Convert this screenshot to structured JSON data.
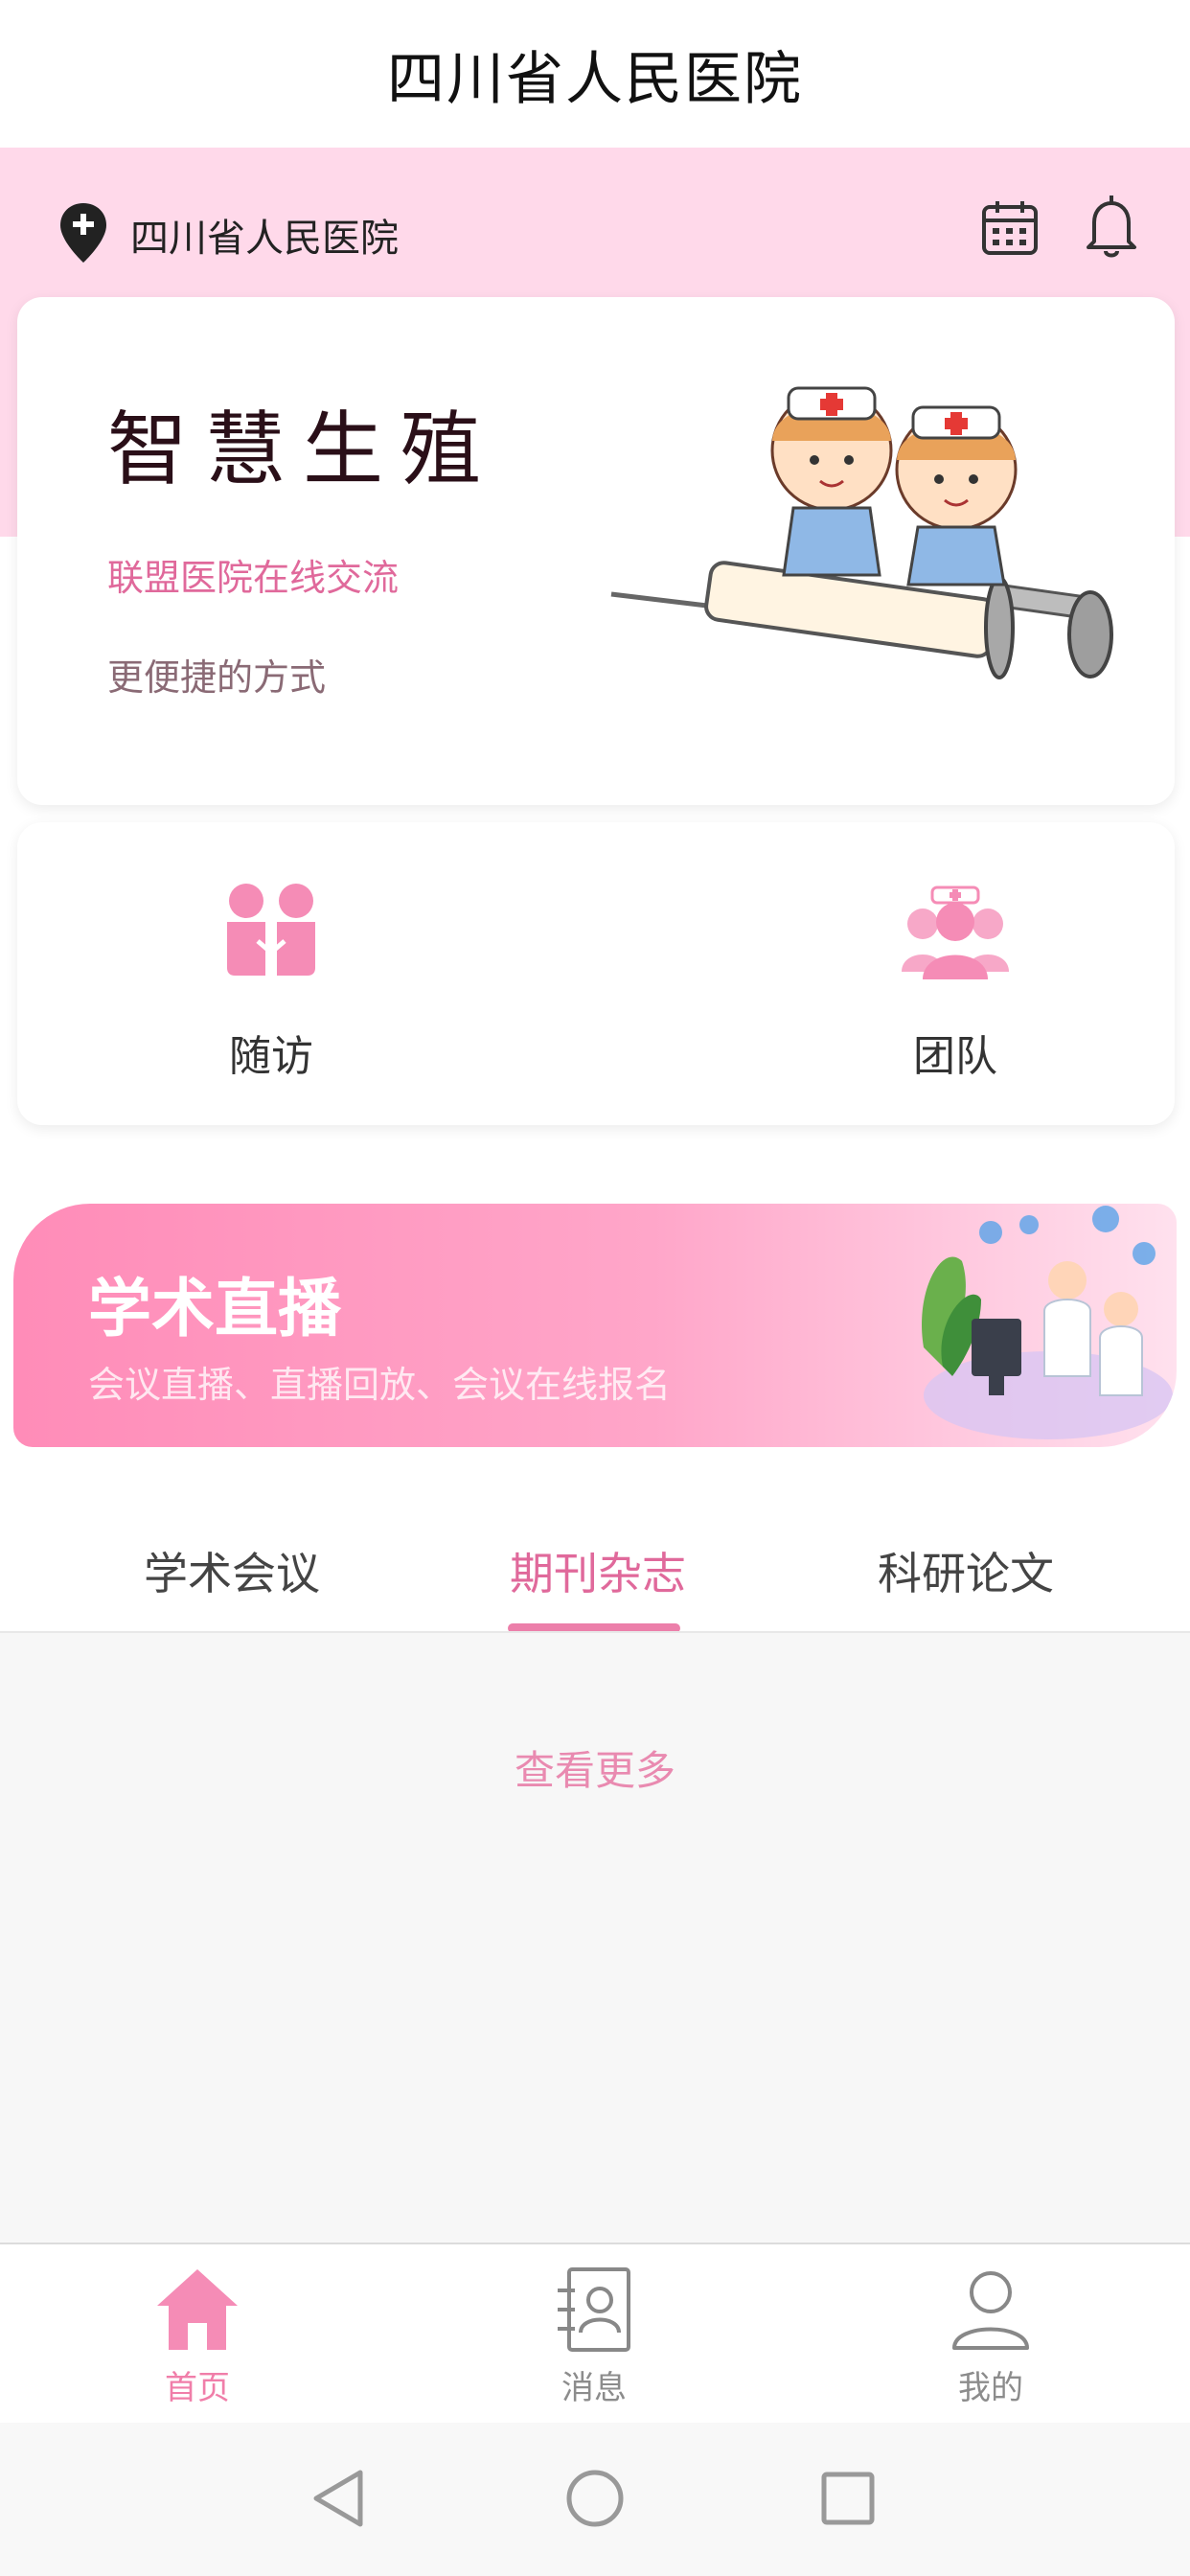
{
  "app": {
    "title": "四川省人民医院"
  },
  "header": {
    "location": "四川省人民医院",
    "location_icon": "location-pin-icon",
    "calendar_icon": "calendar-icon",
    "bell_icon": "bell-icon",
    "band_color": "#ffd9ea"
  },
  "hero": {
    "title": "智慧生殖",
    "subtitle_accent": "联盟医院在线交流",
    "subtitle": "更便捷的方式",
    "illustration": "nurses-on-syringe-illustration"
  },
  "quick_actions": [
    {
      "label": "随访",
      "icon": "follow-up-icon"
    },
    {
      "label": "团队",
      "icon": "team-icon"
    }
  ],
  "banner": {
    "title": "学术直播",
    "subtitle": "会议直播、直播回放、会议在线报名",
    "illustration": "doctors-consultation-illustration"
  },
  "tabs": [
    {
      "label": "学术会议",
      "active": false
    },
    {
      "label": "期刊杂志",
      "active": true
    },
    {
      "label": "科研论文",
      "active": false
    }
  ],
  "content": {
    "more_label": "查看更多"
  },
  "bottom_nav": [
    {
      "label": "首页",
      "icon": "home-icon",
      "active": true
    },
    {
      "label": "消息",
      "icon": "contacts-card-icon",
      "active": false
    },
    {
      "label": "我的",
      "icon": "user-icon",
      "active": false
    }
  ],
  "system_nav": {
    "back_icon": "back-triangle-icon",
    "home_icon": "home-circle-icon",
    "recent_icon": "recent-apps-square-icon"
  },
  "colors": {
    "accent": "#e0699b",
    "banner_start": "#ff8cb8",
    "banner_end": "#ffe1ee"
  }
}
